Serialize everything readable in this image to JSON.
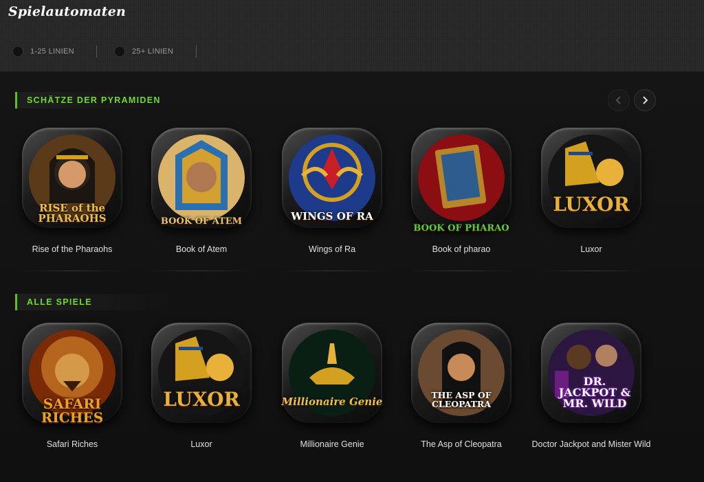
{
  "header": {
    "title": "Spielautomaten",
    "filters": [
      {
        "label": "1-25 LINIEN"
      },
      {
        "label": "25+ LINIEN"
      }
    ]
  },
  "sections": [
    {
      "title": "SCHÄTZE DER PYRAMIDEN",
      "games": [
        {
          "name": "Rise of the Pharaohs",
          "logo": "RISE of the PHARAOHS",
          "color": "#c79a2b"
        },
        {
          "name": "Book of Atem",
          "logo": "BOOK OF ATEM",
          "color": "#c9a24a"
        },
        {
          "name": "Wings of Ra",
          "logo": "WINGS OF RA",
          "color": "#1e3a8a"
        },
        {
          "name": "Book of pharao",
          "logo": "BOOK OF PHARAO",
          "color": "#8b0e12"
        },
        {
          "name": "Luxor",
          "logo": "LUXOR",
          "color": "#1a1a1a"
        }
      ]
    },
    {
      "title": "ALLE SPIELE",
      "games": [
        {
          "name": "Safari Riches",
          "logo": "SAFARI RICHES",
          "color": "#7a2a05"
        },
        {
          "name": "Luxor",
          "logo": "LUXOR",
          "color": "#1a1a1a"
        },
        {
          "name": "Millionaire Genie",
          "logo": "Millionaire Genie",
          "color": "#0a1f14"
        },
        {
          "name": "The Asp of Cleopatra",
          "logo": "THE ASP OF CLEOPATRA",
          "color": "#4a3020"
        },
        {
          "name": "Doctor Jackpot and Mister Wild",
          "logo": "DR. JACKPOT & MR. WILD",
          "color": "#2b1640"
        }
      ]
    }
  ],
  "colors": {
    "accent": "#6fdc2b",
    "gold": "#e8b23a"
  }
}
